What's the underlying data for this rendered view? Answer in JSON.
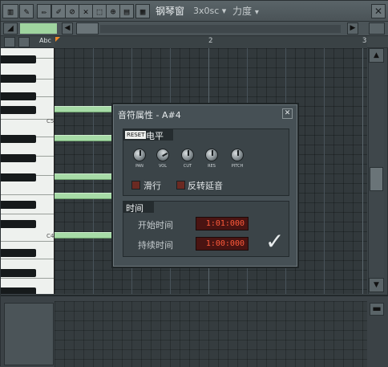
{
  "window": {
    "title": "钢琴窗",
    "tool_combo": "3x0sc",
    "mode_combo": "力度",
    "close_glyph": "✕"
  },
  "toolbar": {
    "tools": [
      "piano-keys",
      "wrench",
      "pencil",
      "brush",
      "delete",
      "mute",
      "select",
      "zoom",
      "play",
      "grid"
    ]
  },
  "ruler": {
    "abc_label": "Abc",
    "bar2": "2",
    "bar3": "3"
  },
  "keyboard": {
    "c5_label": "C5",
    "c4_label": "C4"
  },
  "dialog": {
    "title": "音符属性 - A#4",
    "close_glyph": "✕",
    "levels": {
      "reset": "RESET",
      "header": "电平",
      "knobs": [
        "PAN",
        "VOL",
        "CUT",
        "RES",
        "PITCH"
      ],
      "slide": "滑行",
      "portamento": "反转延音"
    },
    "time": {
      "header": "时间",
      "start_label": "开始时间",
      "start_value": "1:01:000",
      "length_label": "持续时间",
      "length_value": "1:00:000"
    },
    "ok_glyph": "✓"
  },
  "colors": {
    "note": "#a7dba7",
    "display_text": "#ff5a3a",
    "marker": "#f08a2a"
  }
}
